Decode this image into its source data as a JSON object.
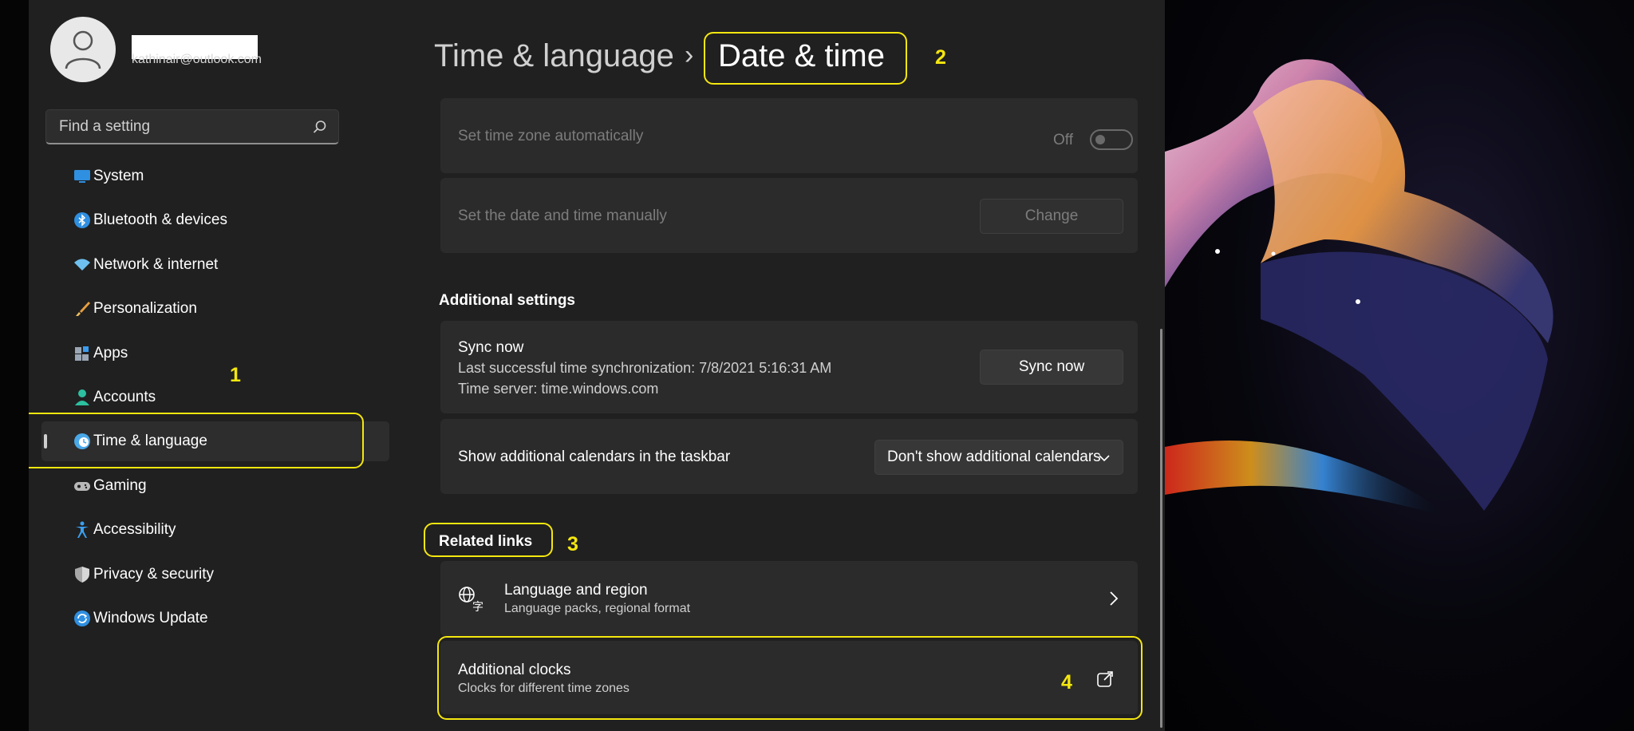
{
  "user": {
    "email": "kathinair@outlook.com"
  },
  "search": {
    "placeholder": "Find a setting"
  },
  "nav": [
    {
      "label": "System",
      "icon": "monitor-icon",
      "color": "#2f8fe0"
    },
    {
      "label": "Bluetooth & devices",
      "icon": "bluetooth-icon",
      "color": "#2f8fe0"
    },
    {
      "label": "Network & internet",
      "icon": "wifi-icon",
      "color": "#6ec0f0"
    },
    {
      "label": "Personalization",
      "icon": "brush-icon",
      "color": "#e8a040"
    },
    {
      "label": "Apps",
      "icon": "apps-icon",
      "color": "#9aa6b4"
    },
    {
      "label": "Accounts",
      "icon": "person-icon",
      "color": "#2cc0a0"
    },
    {
      "label": "Time & language",
      "icon": "clock-globe-icon",
      "color": "#4aa8e8",
      "selected": true
    },
    {
      "label": "Gaming",
      "icon": "gamepad-icon",
      "color": "#b8b8b8"
    },
    {
      "label": "Accessibility",
      "icon": "accessibility-icon",
      "color": "#3ba0f0"
    },
    {
      "label": "Privacy & security",
      "icon": "shield-icon",
      "color": "#a8a8a8"
    },
    {
      "label": "Windows Update",
      "icon": "update-icon",
      "color": "#2f8fe0"
    }
  ],
  "header": {
    "parent": "Time & language",
    "chevron": "›",
    "title": "Date & time"
  },
  "timezone_auto": {
    "label": "Set time zone automatically",
    "state": "Off"
  },
  "manual": {
    "label": "Set the date and time manually",
    "button": "Change"
  },
  "additional": {
    "heading": "Additional settings",
    "sync": {
      "title": "Sync now",
      "last": "Last successful time synchronization: 7/8/2021 5:16:31 AM",
      "server": "Time server: time.windows.com",
      "button": "Sync now"
    },
    "calendars": {
      "label": "Show additional calendars in the taskbar",
      "value": "Don't show additional calendars"
    }
  },
  "related": {
    "heading": "Related links",
    "language": {
      "title": "Language and region",
      "subtitle": "Language packs, regional format"
    },
    "clocks": {
      "title": "Additional clocks",
      "subtitle": "Clocks for different time zones"
    }
  },
  "annotations": [
    "1",
    "2",
    "3",
    "4"
  ],
  "accent": "#f5e70f"
}
